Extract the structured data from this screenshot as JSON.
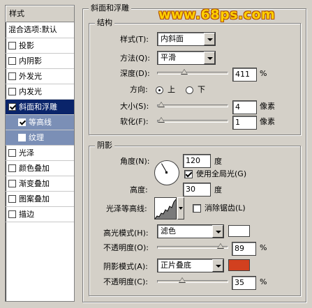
{
  "styles": {
    "header": "样式",
    "items": [
      {
        "label": "混合选项:默认",
        "checkbox": false
      },
      {
        "label": "投影",
        "checkbox": true,
        "checked": false
      },
      {
        "label": "内阴影",
        "checkbox": true,
        "checked": false
      },
      {
        "label": "外发光",
        "checkbox": true,
        "checked": false
      },
      {
        "label": "内发光",
        "checkbox": true,
        "checked": false
      },
      {
        "label": "斜面和浮雕",
        "checkbox": true,
        "checked": true
      },
      {
        "label": "等高线",
        "checkbox": true,
        "checked": true
      },
      {
        "label": "纹理",
        "checkbox": true,
        "checked": false
      },
      {
        "label": "光泽",
        "checkbox": true,
        "checked": false
      },
      {
        "label": "颜色叠加",
        "checkbox": true,
        "checked": false
      },
      {
        "label": "渐变叠加",
        "checkbox": true,
        "checked": false
      },
      {
        "label": "图案叠加",
        "checkbox": true,
        "checked": false
      },
      {
        "label": "描边",
        "checkbox": true,
        "checked": false
      }
    ]
  },
  "watermark": "www.68ps.com",
  "bevel": {
    "title": "斜面和浮雕",
    "structure": {
      "title": "结构",
      "style_label": "样式(T):",
      "style_value": "内斜面",
      "technique_label": "方法(Q):",
      "technique_value": "平滑",
      "depth_label": "深度(D):",
      "depth_value": "411",
      "depth_unit": "%",
      "direction_label": "方向:",
      "direction_up": "上",
      "direction_down": "下",
      "size_label": "大小(S):",
      "size_value": "4",
      "size_unit": "像素",
      "soften_label": "软化(F):",
      "soften_value": "1",
      "soften_unit": "像素"
    },
    "shading": {
      "title": "阴影",
      "angle_label": "角度(N):",
      "angle_value": "120",
      "angle_unit": "度",
      "global_light_label": "使用全局光(G)",
      "altitude_label": "高度:",
      "altitude_value": "30",
      "altitude_unit": "度",
      "gloss_contour_label": "光泽等高线:",
      "anti_aliased_label": "消除锯齿(L)",
      "highlight_mode_label": "高光模式(H):",
      "highlight_mode_value": "滤色",
      "highlight_color": "#ffffff",
      "highlight_opacity_label": "不透明度(O):",
      "highlight_opacity_value": "89",
      "highlight_opacity_unit": "%",
      "shadow_mode_label": "阴影模式(A):",
      "shadow_mode_value": "正片叠底",
      "shadow_color": "#d2401f",
      "shadow_opacity_label": "不透明度(C):",
      "shadow_opacity_value": "35",
      "shadow_opacity_unit": "%"
    }
  }
}
